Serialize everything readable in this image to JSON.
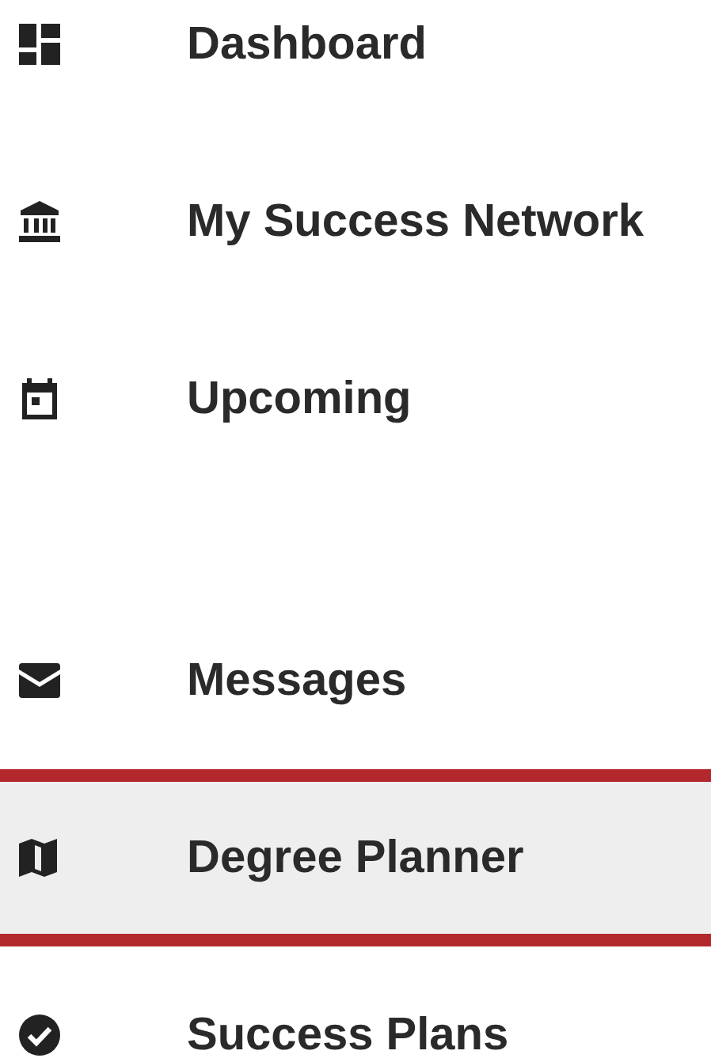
{
  "groups": [
    {
      "items": [
        {
          "label": "Dashboard",
          "kind": "dashboard",
          "selected": false
        },
        {
          "label": "My Success Network",
          "kind": "network",
          "selected": false
        },
        {
          "label": "Upcoming",
          "kind": "calendar",
          "selected": false
        }
      ]
    },
    {
      "items": [
        {
          "label": "Messages",
          "kind": "mail",
          "selected": false
        },
        {
          "label": "Degree Planner",
          "kind": "map",
          "selected": true
        },
        {
          "label": "Success Plans",
          "kind": "check",
          "selected": false
        }
      ]
    }
  ]
}
